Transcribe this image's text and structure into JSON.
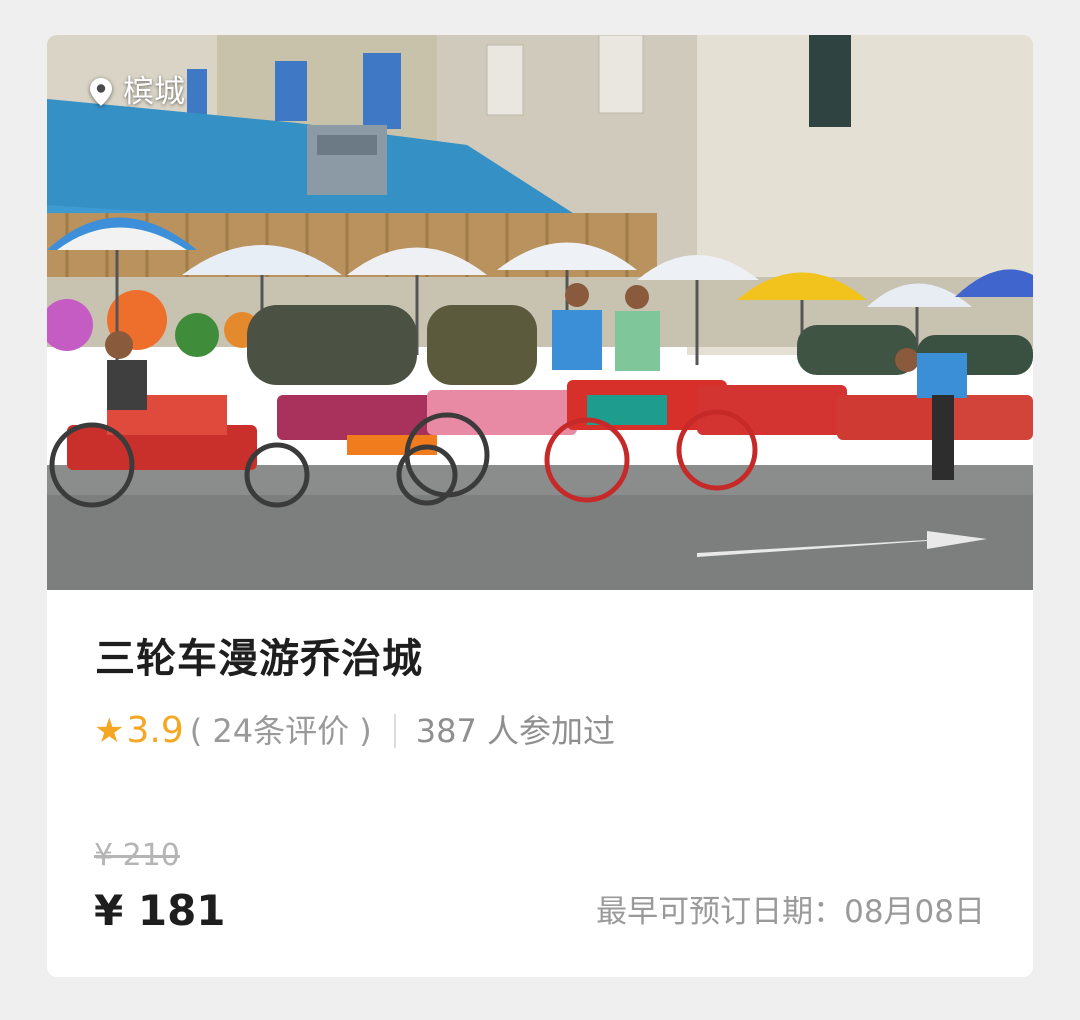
{
  "location": {
    "icon": "location-pin-icon",
    "name": "槟城"
  },
  "tour": {
    "title": "三轮车漫游乔治城",
    "rating": {
      "star": "★",
      "score": "3.9",
      "reviews": "( 24条评价 )",
      "color": "#f5a623"
    },
    "participants": "387 人参加过"
  },
  "pricing": {
    "original_price": "¥ 210",
    "current_price": "¥ 181",
    "earliest_booking": "最早可预订日期：08月08日"
  },
  "colors": {
    "background": "#efefef",
    "card": "#ffffff",
    "accent": "#f5a623",
    "title_text": "#1e1e1e",
    "muted_text": "#9a9a9a"
  }
}
